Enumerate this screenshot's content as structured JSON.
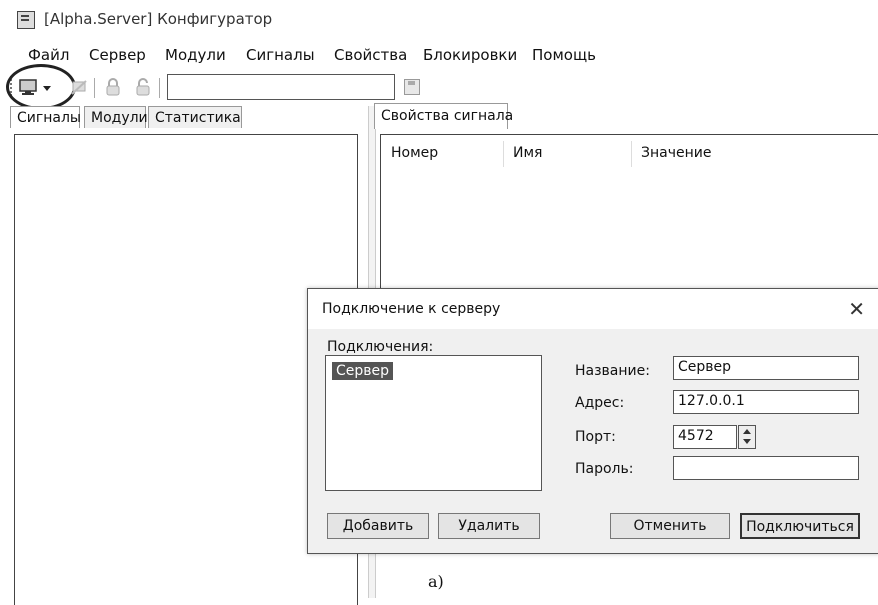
{
  "window": {
    "title": "[Alpha.Server] Конфигуратор",
    "app_icon": "app-window-icon"
  },
  "menu": [
    "Файл",
    "Сервер",
    "Модули",
    "Сигналы",
    "Свойства",
    "Блокировки",
    "Помощь"
  ],
  "toolbar": {
    "connect_icon": "computer-monitor-icon",
    "search_value": ""
  },
  "left_tabs": [
    "Сигналы",
    "Модули",
    "Статистика"
  ],
  "right_tab": "Свойства сигнала",
  "signal_table": {
    "columns": [
      "Номер",
      "Имя",
      "Значение"
    ]
  },
  "dialog": {
    "title": "Подключение к серверу",
    "close_glyph": "✕",
    "connections_label": "Подключения:",
    "connections": [
      "Сервер"
    ],
    "name_label": "Название:",
    "name_value": "Сервер",
    "address_label": "Адрес:",
    "address_value": "127.0.0.1",
    "port_label": "Порт:",
    "port_value": "4572",
    "password_label": "Пароль:",
    "password_value": "",
    "add_button": "Добавить",
    "delete_button": "Удалить",
    "cancel_button": "Отменить",
    "connect_button": "Подключиться"
  },
  "caption": "а)"
}
